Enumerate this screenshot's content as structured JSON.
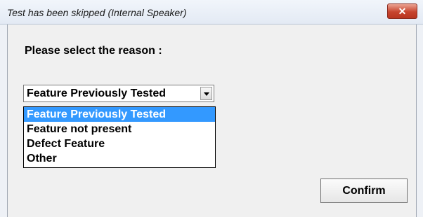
{
  "window": {
    "title": "Test has been skipped (Internal Speaker)",
    "close_icon": "close-icon"
  },
  "dialog": {
    "prompt": "Please select the reason :",
    "dropdown": {
      "selected_value": "Feature Previously Tested",
      "options": [
        "Feature Previously Tested",
        "Feature not present",
        "Defect Feature",
        "Other"
      ],
      "highlighted_index": 0,
      "highlight_color": "#3399ff"
    },
    "confirm_label": "Confirm"
  }
}
